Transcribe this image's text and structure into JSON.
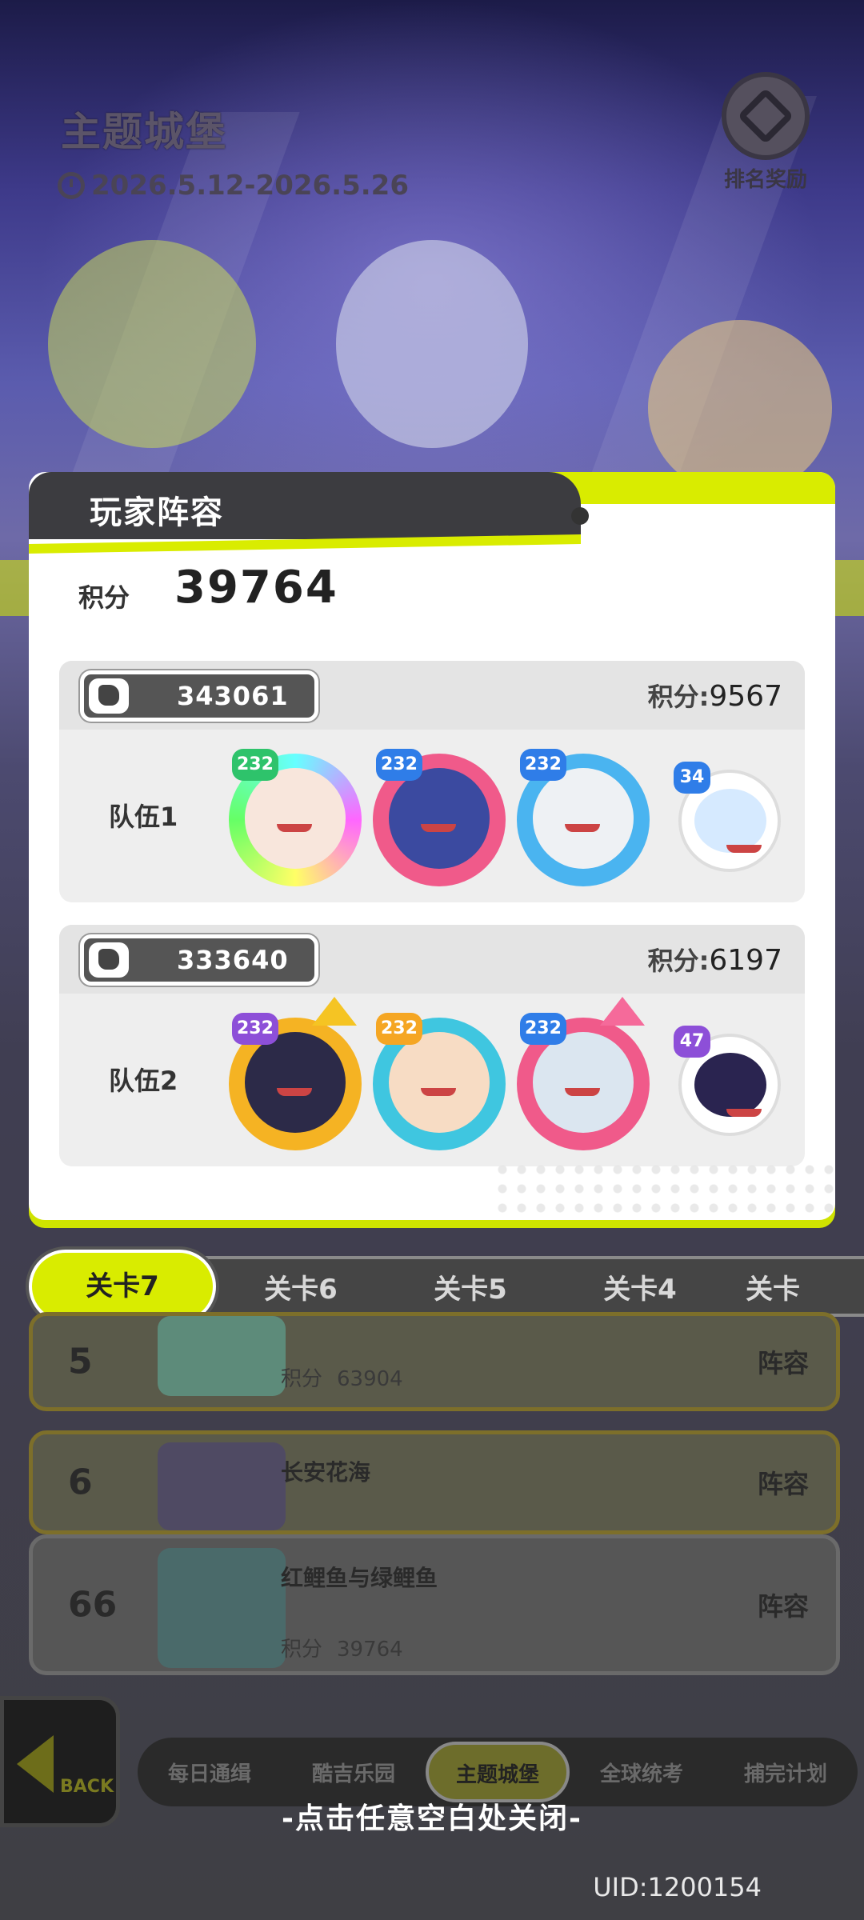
{
  "header": {
    "title": "主题城堡",
    "date_range": "2026.5.12-2026.5.26",
    "rank_reward_label": "排名奖励"
  },
  "modal": {
    "title": "玩家阵容",
    "total_label": "积分",
    "total_value": "39764",
    "teams": [
      {
        "player_id": "343061",
        "score_label": "积分:",
        "score": "9567",
        "name": "队伍1",
        "members": [
          {
            "level": "232"
          },
          {
            "level": "232"
          },
          {
            "level": "232"
          },
          {
            "level": "34"
          }
        ]
      },
      {
        "player_id": "333640",
        "score_label": "积分:",
        "score": "6197",
        "name": "队伍2",
        "members": [
          {
            "level": "232"
          },
          {
            "level": "232"
          },
          {
            "level": "232"
          },
          {
            "level": "47"
          }
        ]
      }
    ]
  },
  "stage_tabs": [
    "关卡7",
    "关卡6",
    "关卡5",
    "关卡4",
    "关卡"
  ],
  "ranking_list": [
    {
      "rank": "5",
      "name": "",
      "score_label": "积分",
      "score": "63904",
      "lineup_label": "阵容"
    },
    {
      "rank": "6",
      "name": "长安花海",
      "score_label": "",
      "score": "",
      "lineup_label": "阵容"
    },
    {
      "rank": "66",
      "name": "红鲤鱼与绿鲤鱼",
      "score_label": "积分",
      "score": "39764",
      "lineup_label": "阵容"
    }
  ],
  "bottom_nav": [
    "每日通缉",
    "酷吉乐园",
    "主题城堡",
    "全球统考",
    "捕完计划"
  ],
  "back_label": "BACK",
  "close_hint": "-点击任意空白处关闭-",
  "uid": "UID:1200154",
  "colors": {
    "accent": "#d9ec00",
    "panel_dark": "#3c3c40"
  }
}
